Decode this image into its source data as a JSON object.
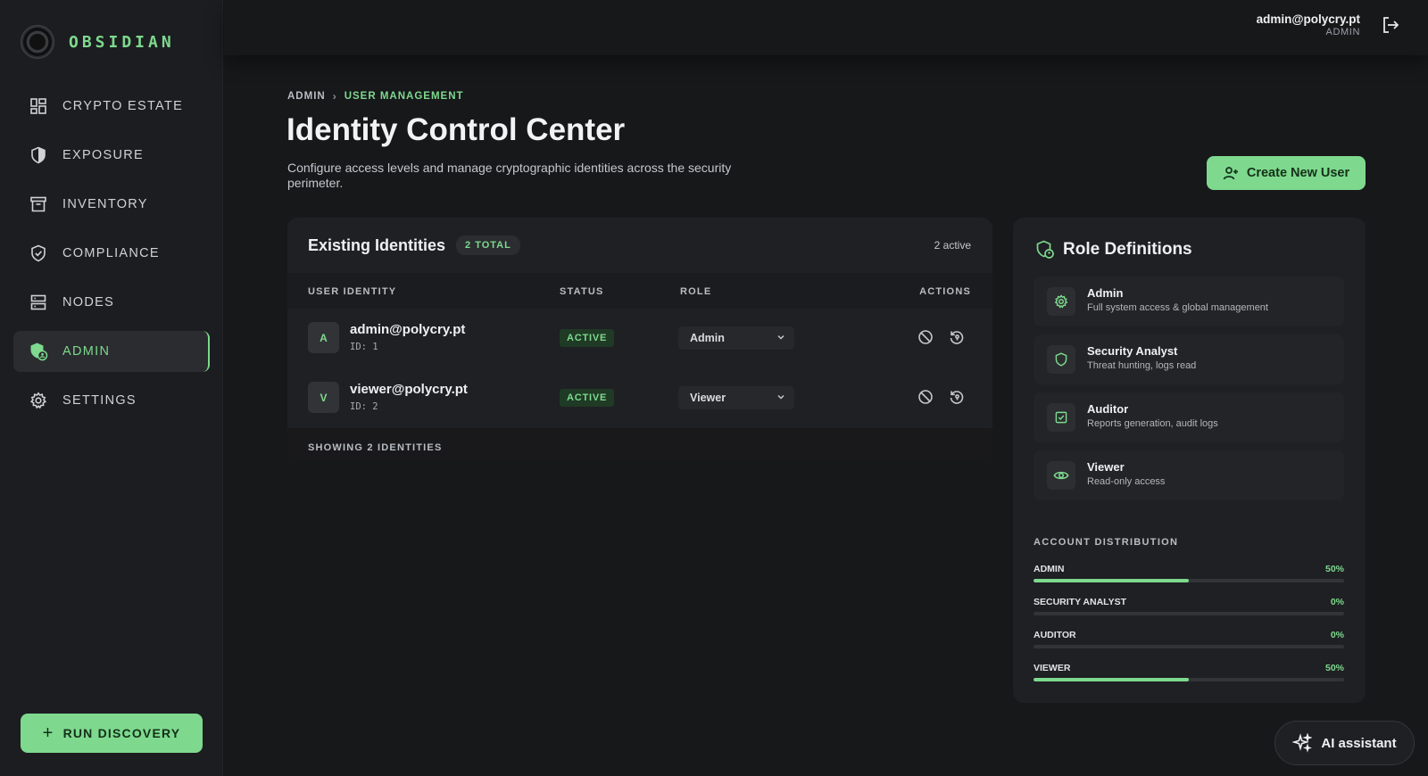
{
  "brand": {
    "name": "OBSIDIAN",
    "logo_icon": "obsidian-logo"
  },
  "sidebar": {
    "items": [
      {
        "label": "CRYPTO ESTATE",
        "icon": "grid-icon",
        "active": false
      },
      {
        "label": "EXPOSURE",
        "icon": "shield-half-icon",
        "active": false
      },
      {
        "label": "INVENTORY",
        "icon": "archive-icon",
        "active": false
      },
      {
        "label": "COMPLIANCE",
        "icon": "shield-check-icon",
        "active": false
      },
      {
        "label": "NODES",
        "icon": "server-icon",
        "active": false
      },
      {
        "label": "ADMIN",
        "icon": "shield-user-icon",
        "active": true
      },
      {
        "label": "SETTINGS",
        "icon": "gear-icon",
        "active": false
      }
    ],
    "run_discovery": "RUN DISCOVERY"
  },
  "header": {
    "user_email": "admin@polycry.pt",
    "user_role": "ADMIN",
    "logout_icon": "logout-icon"
  },
  "breadcrumb": {
    "parent": "ADMIN",
    "separator": "›",
    "current": "USER MANAGEMENT"
  },
  "page": {
    "title": "Identity Control Center",
    "description": "Configure access levels and manage cryptographic identities across the security perimeter.",
    "create_button": "Create New User"
  },
  "identities": {
    "title": "Existing Identities",
    "total_badge": "2 TOTAL",
    "active_count": "2 active",
    "columns": [
      "USER IDENTITY",
      "STATUS",
      "ROLE",
      "ACTIONS"
    ],
    "rows": [
      {
        "avatar": "A",
        "email": "admin@polycry.pt",
        "id": "ID: 1",
        "status": "ACTIVE",
        "role": "Admin"
      },
      {
        "avatar": "V",
        "email": "viewer@polycry.pt",
        "id": "ID: 2",
        "status": "ACTIVE",
        "role": "Viewer"
      }
    ],
    "footer": "SHOWING 2 IDENTITIES"
  },
  "roles": {
    "title": "Role Definitions",
    "items": [
      {
        "name": "Admin",
        "desc": "Full system access & global management",
        "icon": "gear-icon"
      },
      {
        "name": "Security Analyst",
        "desc": "Threat hunting, logs read",
        "icon": "shield-icon"
      },
      {
        "name": "Auditor",
        "desc": "Reports generation, audit logs",
        "icon": "checkbox-icon"
      },
      {
        "name": "Viewer",
        "desc": "Read-only access",
        "icon": "eye-icon"
      }
    ],
    "distribution_title": "ACCOUNT DISTRIBUTION",
    "distribution": [
      {
        "label": "ADMIN",
        "pct_text": "50%",
        "fraction": 0.5
      },
      {
        "label": "SECURITY ANALYST",
        "pct_text": "0%",
        "fraction": 0
      },
      {
        "label": "AUDITOR",
        "pct_text": "0%",
        "fraction": 0
      },
      {
        "label": "VIEWER",
        "pct_text": "50%",
        "fraction": 0.5
      }
    ]
  },
  "assistant": {
    "label": "AI assistant"
  },
  "colors": {
    "accent": "#7ed98e",
    "background": "#17181a",
    "card": "#1f2023"
  }
}
